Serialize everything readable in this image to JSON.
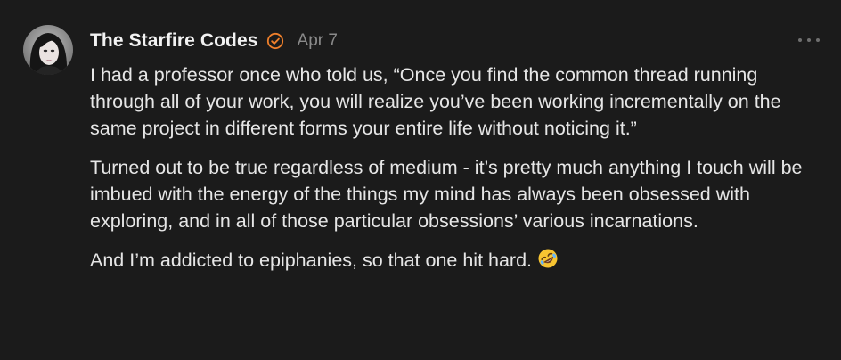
{
  "comment": {
    "author": "The Starfire Codes",
    "date": "Apr 7",
    "paragraphs": [
      "I had a professor once who told us, “Once you find the common thread running through all of your work, you will realize you’ve been working incrementally on the same project in different forms your entire life without noticing it.”",
      "Turned out to be true regardless of medium - it’s pretty much anything I touch will be imbued with the energy of the things my mind has always been obsessed with exploring, and in all of those particular obsessions’ various incarnations.",
      "And I’m addicted to epiphanies, so that one hit hard."
    ],
    "verified_icon": "check-circle-icon",
    "more_icon": "more-horizontal-icon",
    "emoji_icon": "rolling-on-floor-laughing-emoji",
    "colors": {
      "background": "#1b1b1b",
      "text": "#e6e6e6",
      "muted": "#8a8a8a",
      "accent": "#f0802b"
    }
  }
}
